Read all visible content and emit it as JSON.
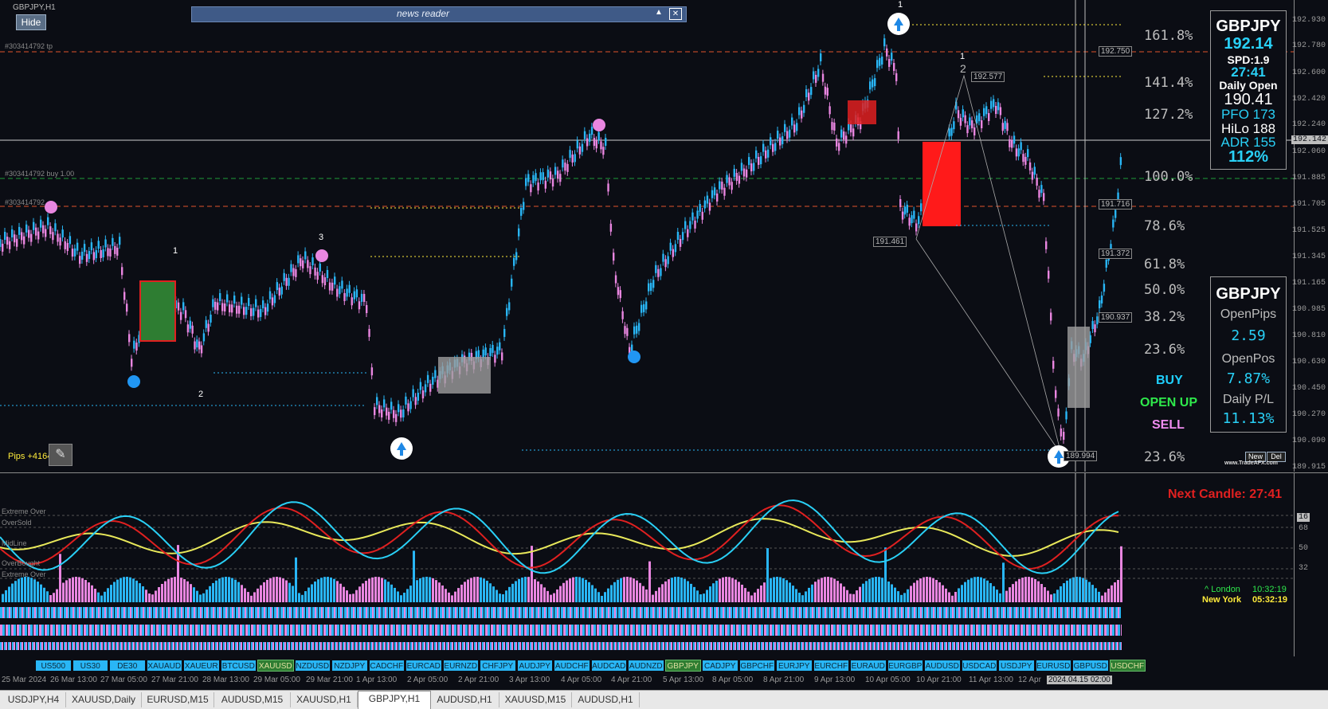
{
  "window": {
    "title": "GBPJPY,H1"
  },
  "toolbar": {
    "hide_label": "Hide"
  },
  "news": {
    "title": "news reader"
  },
  "orders": {
    "tp_label": "#303414792 tp",
    "buy_label": "#303414792 buy 1.00",
    "sl_label": "#303414792"
  },
  "info_panel": {
    "symbol": "GBPJPY",
    "price": "192.14",
    "spread": "SPD:1.9",
    "timer": "27:41",
    "daily_open_label": "Daily Open",
    "daily_open": "190.41",
    "pfo": "PFO 173",
    "hilo": "HiLo 188",
    "adr": "ADR 155",
    "pct": "112%"
  },
  "pos_panel": {
    "symbol": "GBPJPY",
    "open_pips_label": "OpenPips",
    "open_pips": "2.59",
    "open_pos_label": "OpenPos",
    "open_pos": "7.87%",
    "daily_pl_label": "Daily P/L",
    "daily_pl": "11.13%"
  },
  "signals": {
    "buy": "BUY",
    "open_up": "OPEN UP",
    "sell": "SELL"
  },
  "fib_levels": [
    "161.8%",
    "141.4%",
    "127.2%",
    "100.0%",
    "78.6%",
    "61.8%",
    "50.0%",
    "38.2%",
    "23.6%",
    "23.6%"
  ],
  "wave_labels": [
    "1",
    "2",
    "3",
    "1",
    "2",
    "1",
    "2"
  ],
  "price_tags": [
    "192.750",
    "192.577",
    "191.716",
    "191.461",
    "191.372",
    "190.937",
    "189.994"
  ],
  "price_axis": [
    "192.930",
    "192.780",
    "192.600",
    "192.420",
    "192.240",
    "192.142",
    "192.060",
    "191.885",
    "191.705",
    "191.525",
    "191.345",
    "191.165",
    "190.985",
    "190.810",
    "190.630",
    "190.450",
    "190.270",
    "190.090",
    "189.915"
  ],
  "price_axis_current": "192.142",
  "pips_label": "Pips +4164.6",
  "new_del": {
    "new": "New",
    "del": "Del"
  },
  "watermark": "www.TradeAFX.com",
  "indicator": {
    "extreme_over": "Extreme Over",
    "oversold": "OverSold",
    "midline": "MidLine",
    "overbought": "OverBought",
    "extreme_over2": "Extreme Over",
    "next_candle": "Next Candle: 27:41",
    "london_label": "^ London",
    "london_time": "10:32:19",
    "newyork_label": "New York",
    "newyork_time": "05:32:19",
    "levels": [
      "16",
      "68",
      "50",
      "32"
    ]
  },
  "symbols": [
    "US500",
    "US30",
    "DE30",
    "XAUAUD",
    "XAUEUR",
    "BTCUSD",
    "XAUUSD",
    "NZDUSD",
    "NZDJPY",
    "CADCHF",
    "EURCAD",
    "EURNZD",
    "CHFJPY",
    "AUDJPY",
    "AUDCHF",
    "AUDCAD",
    "AUDNZD",
    "GBPJPY",
    "CADJPY",
    "GBPCHF",
    "EURJPY",
    "EURCHF",
    "EURAUD",
    "EURGBP",
    "AUDUSD",
    "USDCAD",
    "USDJPY",
    "EURUSD",
    "GBPUSD",
    "USDCHF"
  ],
  "time_labels": [
    "25 Mar 2024",
    "26 Mar 13:00",
    "27 Mar 05:00",
    "27 Mar 21:00",
    "28 Mar 13:00",
    "29 Mar 05:00",
    "29 Mar 21:00",
    "1 Apr 13:00",
    "2 Apr 05:00",
    "2 Apr 21:00",
    "3 Apr 13:00",
    "4 Apr 05:00",
    "4 Apr 21:00",
    "5 Apr 13:00",
    "8 Apr 05:00",
    "8 Apr 21:00",
    "9 Apr 13:00",
    "10 Apr 05:00",
    "10 Apr 21:00",
    "11 Apr 13:00",
    "12 Apr"
  ],
  "time_cursor": "2024.04.15 02:00",
  "tabs": [
    "USDJPY,H4",
    "XAUUSD,Daily",
    "EURUSD,M15",
    "AUDUSD,M15",
    "XAUUSD,H1",
    "GBPJPY,H1",
    "AUDUSD,H1",
    "XAUUSD,M15",
    "AUDUSD,H1"
  ],
  "colors": {
    "bull": "#29b6f6",
    "bear": "#e986e0",
    "tp_line": "#e0542c",
    "buy_line": "#1f9d3a",
    "accent_cyan": "#29d0f6",
    "signal_buy": "#1fd0ff",
    "signal_up": "#2ee84b",
    "signal_sell": "#f08cf0",
    "next_candle": "#e02020"
  }
}
